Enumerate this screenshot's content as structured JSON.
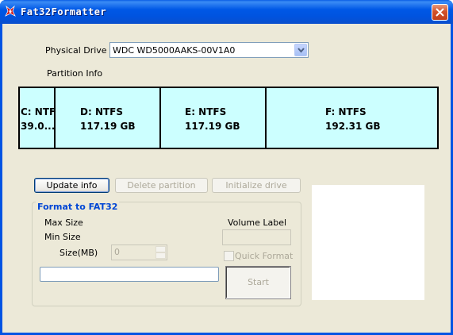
{
  "window": {
    "title": "Fat32Formatter",
    "icon": "app-logo-icon",
    "close_icon": "close-icon"
  },
  "physical_drive": {
    "label": "Physical Drive",
    "selected": "WDC WD5000AAKS-00V1A0"
  },
  "partition_info_label": "Partition Info",
  "partitions": [
    {
      "name": "C: NTFS",
      "size": "39.0..."
    },
    {
      "name": "D: NTFS",
      "size": "117.19 GB"
    },
    {
      "name": "E: NTFS",
      "size": "117.19 GB"
    },
    {
      "name": "F: NTFS",
      "size": "192.31 GB"
    }
  ],
  "buttons": {
    "update_info": "Update info",
    "delete_partition": "Delete partition",
    "initialize_drive": "Initialize drive",
    "start": "Start"
  },
  "format_group": {
    "title": "Format to FAT32",
    "max_size": "Max Size",
    "min_size": "Min Size",
    "size_mb_label": "Size(MB)",
    "size_mb_value": "0",
    "volume_label": "Volume Label",
    "volume_label_value": "",
    "quick_format": "Quick Format",
    "progress": 0
  },
  "colors": {
    "partition_fill": "#ccffff",
    "group_title": "#0046d5",
    "titlebar": "#0058e6"
  }
}
